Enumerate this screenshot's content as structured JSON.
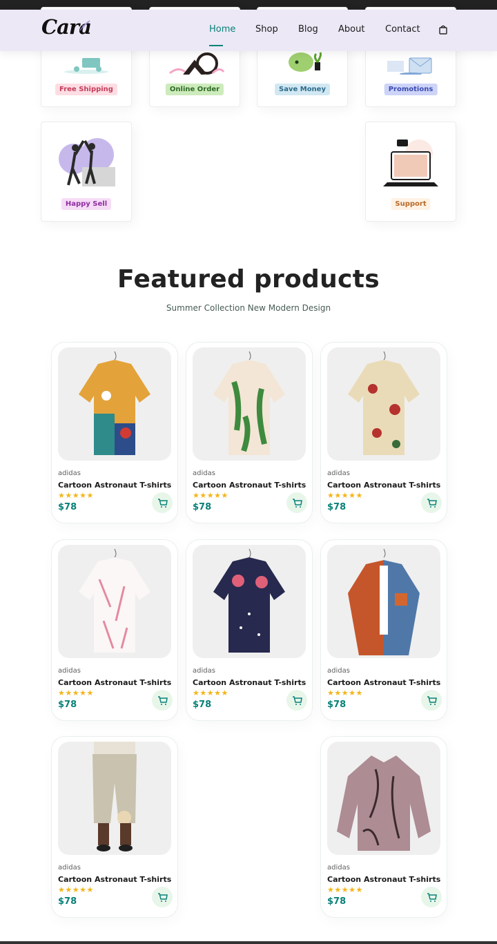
{
  "header": {
    "logo": "Cara",
    "nav": [
      "Home",
      "Shop",
      "Blog",
      "About",
      "Contact"
    ],
    "active": "Home",
    "cart_icon": "shopping-bag-icon"
  },
  "features": [
    {
      "label": "Free Shipping",
      "bg": "#fddde4",
      "icon": "delivery-illustration"
    },
    {
      "label": "Online Order",
      "bg": "#cdebbc",
      "icon": "online-order-illustration"
    },
    {
      "label": "Save Money",
      "bg": "#d1e8f2",
      "icon": "piggy-bank-illustration"
    },
    {
      "label": "Promotions",
      "bg": "#cdd4f8",
      "icon": "promotions-illustration"
    },
    {
      "label": "Happy Sell",
      "bg": "#f6dbf6",
      "icon": "high-five-illustration"
    },
    {
      "label": "Support",
      "bg": "#fff2e5",
      "icon": "support-laptop-illustration"
    }
  ],
  "featured": {
    "title": "Featured products",
    "subtitle": "Summer Collection New Modern Design"
  },
  "products": [
    {
      "brand": "adidas",
      "name": "Cartoon Astronaut T-shirts",
      "stars": "★★★★★",
      "price": "$78"
    },
    {
      "brand": "adidas",
      "name": "Cartoon Astronaut T-shirts",
      "stars": "★★★★★",
      "price": "$78"
    },
    {
      "brand": "adidas",
      "name": "Cartoon Astronaut T-shirts",
      "stars": "★★★★★",
      "price": "$78"
    },
    {
      "brand": "adidas",
      "name": "Cartoon Astronaut T-shirts",
      "stars": "★★★★★",
      "price": "$78"
    },
    {
      "brand": "adidas",
      "name": "Cartoon Astronaut T-shirts",
      "stars": "★★★★★",
      "price": "$78"
    },
    {
      "brand": "adidas",
      "name": "Cartoon Astronaut T-shirts",
      "stars": "★★★★★",
      "price": "$78"
    },
    {
      "brand": "adidas",
      "name": "Cartoon Astronaut T-shirts",
      "stars": "★★★★★",
      "price": "$78"
    },
    {
      "brand": "adidas",
      "name": "Cartoon Astronaut T-shirts",
      "stars": "★★★★★",
      "price": "$78"
    }
  ],
  "colors": {
    "accent": "#088178",
    "star": "#f3b519",
    "header_bg": "#ece8f6"
  }
}
